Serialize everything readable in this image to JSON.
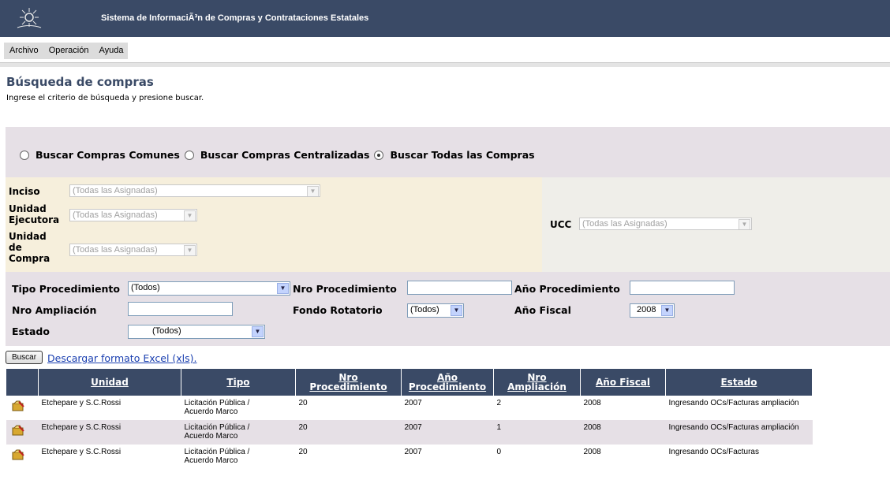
{
  "header": {
    "title": "Sistema de InformaciÃ³n de Compras y Contrataciones Estatales",
    "logo_icon": "sun-emblem-icon"
  },
  "menu": {
    "items": [
      "Archivo",
      "Operación",
      "Ayuda"
    ]
  },
  "page": {
    "title": "Búsqueda de compras",
    "subtitle": "Ingrese el criterio de búsqueda y presione buscar."
  },
  "search_mode": {
    "options": [
      "Buscar Compras Comunes",
      "Buscar Compras Centralizadas",
      "Buscar Todas las Compras"
    ],
    "selected": "Buscar Todas las Compras"
  },
  "org_filters": {
    "inciso": {
      "label": "Inciso",
      "value": "(Todas las Asignadas)"
    },
    "unidad_ejecutora": {
      "label_lines": [
        "Unidad",
        "Ejecutora"
      ],
      "value": "(Todas las Asignadas)"
    },
    "unidad_compra": {
      "label_lines": [
        "Unidad",
        "de",
        "Compra"
      ],
      "value": "(Todas las Asignadas)"
    },
    "ucc": {
      "label": "UCC",
      "value": "(Todas las Asignadas)"
    }
  },
  "filters": {
    "tipo_procedimiento": {
      "label": "Tipo Procedimiento",
      "value": "(Todos)"
    },
    "nro_procedimiento": {
      "label": "Nro Procedimiento",
      "value": ""
    },
    "anio_procedimiento": {
      "label": "Año Procedimiento",
      "value": ""
    },
    "nro_ampliacion": {
      "label": "Nro Ampliación",
      "value": ""
    },
    "fondo_rotatorio": {
      "label": "Fondo Rotatorio",
      "value": "(Todos)"
    },
    "anio_fiscal": {
      "label": "Año Fiscal",
      "value": "2008"
    },
    "estado": {
      "label": "Estado",
      "value": "(Todos)"
    }
  },
  "actions": {
    "buscar": "Buscar",
    "excel_link": "Descargar formato Excel (xls)."
  },
  "table": {
    "headers": [
      {
        "lines": [
          "Unidad"
        ]
      },
      {
        "lines": [
          "Tipo"
        ]
      },
      {
        "lines": [
          "Nro",
          "Procedimiento"
        ]
      },
      {
        "lines": [
          "Año",
          "Procedimiento"
        ]
      },
      {
        "lines": [
          "Nro",
          "Ampliación"
        ]
      },
      {
        "lines": [
          "Año Fiscal"
        ]
      },
      {
        "lines": [
          "Estado"
        ]
      }
    ],
    "row_icon": "edit-folder-icon",
    "rows": [
      {
        "unidad": "Etchepare y S.C.Rossi",
        "tipo_lines": [
          "Licitación Pública /",
          "Acuerdo Marco"
        ],
        "nro_proc": "20",
        "anio_proc": "2007",
        "nro_amp": "2",
        "anio_fiscal": "2008",
        "estado": "Ingresando OCs/Facturas ampliación"
      },
      {
        "unidad": "Etchepare y S.C.Rossi",
        "tipo_lines": [
          "Licitación Pública /",
          "Acuerdo Marco"
        ],
        "nro_proc": "20",
        "anio_proc": "2007",
        "nro_amp": "1",
        "anio_fiscal": "2008",
        "estado": "Ingresando OCs/Facturas ampliación"
      },
      {
        "unidad": "Etchepare y S.C.Rossi",
        "tipo_lines": [
          "Licitación Pública /",
          "Acuerdo Marco"
        ],
        "nro_proc": "20",
        "anio_proc": "2007",
        "nro_amp": "0",
        "anio_fiscal": "2008",
        "estado": "Ingresando OCs/Facturas"
      }
    ]
  },
  "colors": {
    "header_bg": "#3a4a66",
    "panel_lavender": "#e6e0e6",
    "panel_cream": "#f6efdc",
    "link": "#1a3fb0"
  }
}
